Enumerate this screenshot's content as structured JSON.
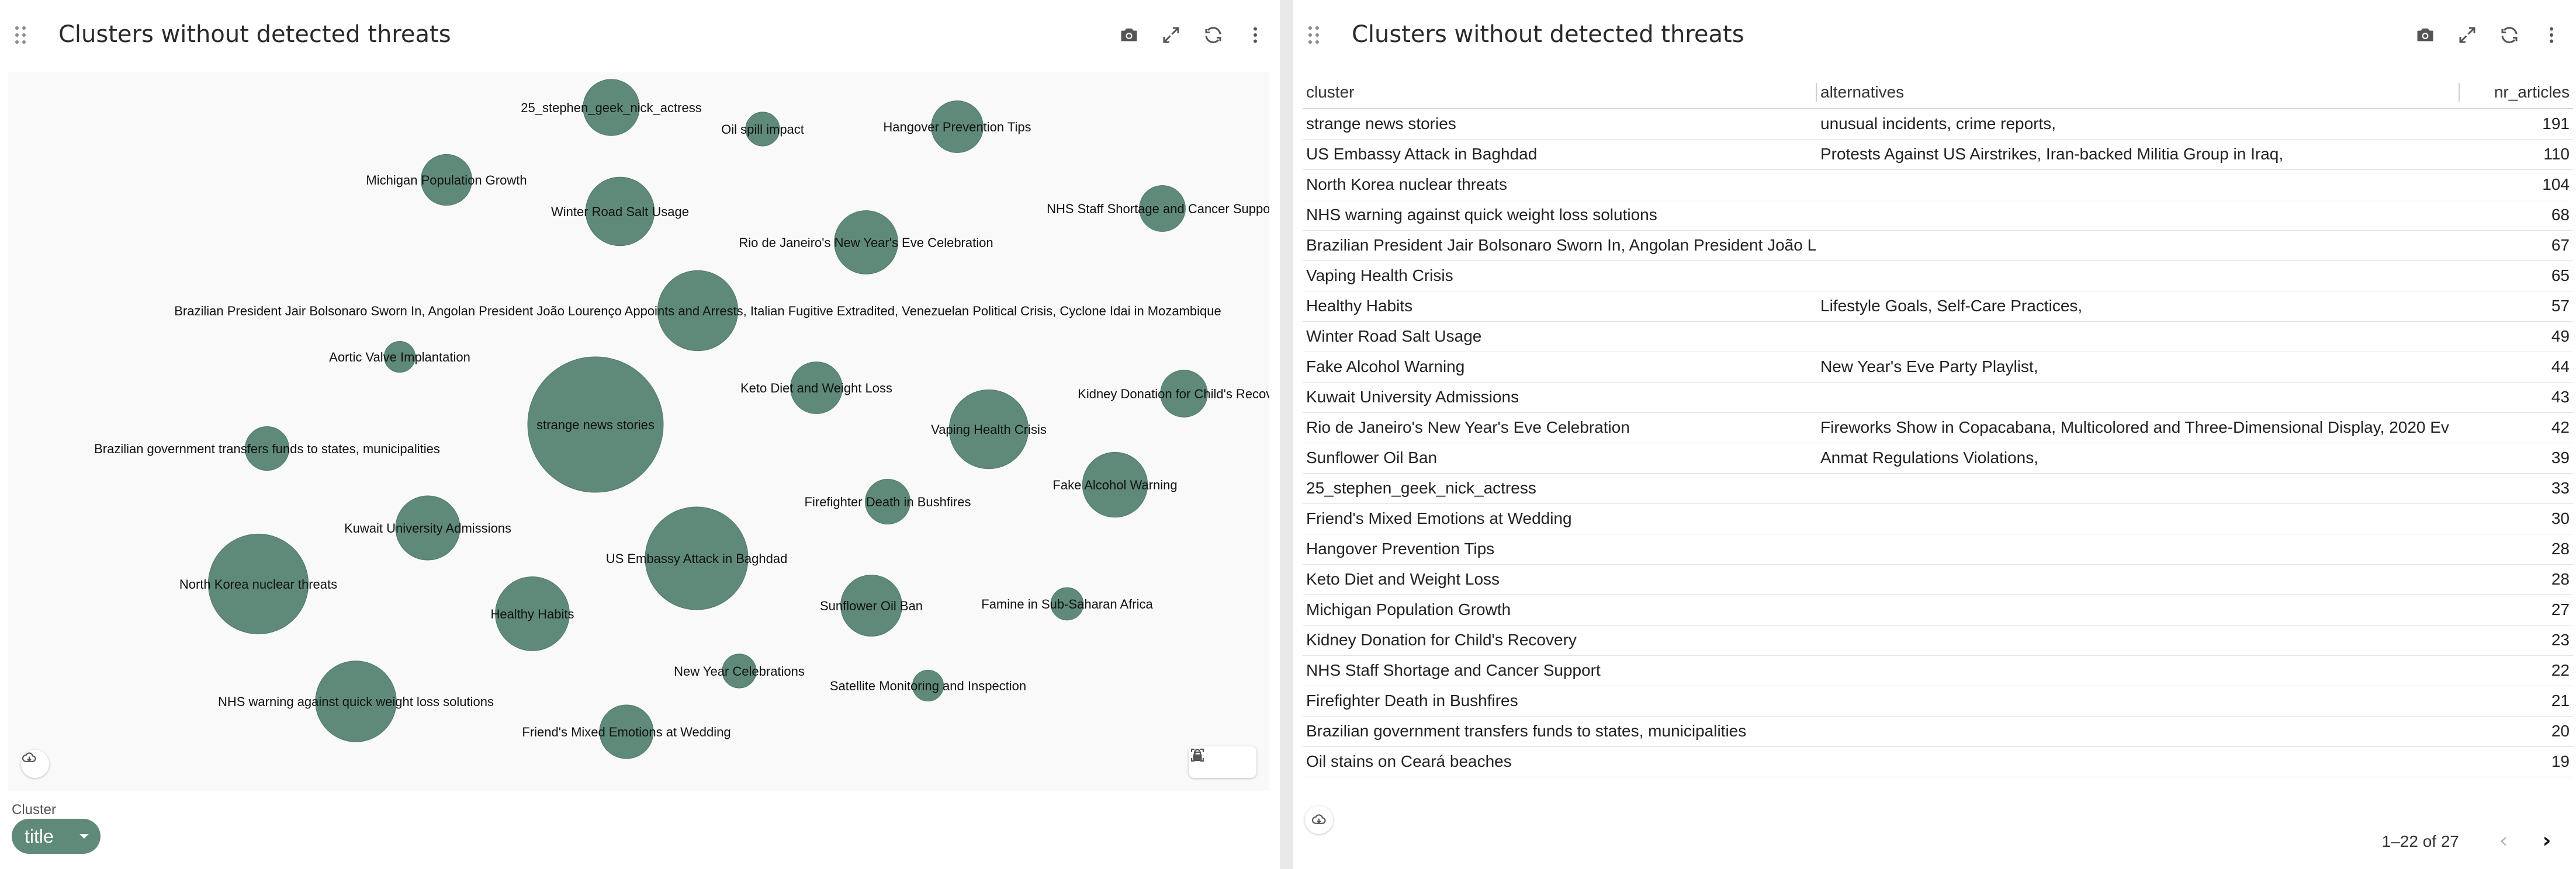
{
  "colors": {
    "bubble": "#5f8a7a",
    "bubble_stroke": "#4f7768",
    "chip": "#5f8a7a"
  },
  "left_panel": {
    "title": "Clusters without detected threats",
    "toolbar_icons": [
      "camera-icon",
      "expand-icon",
      "refresh-icon",
      "more-vertical-icon"
    ],
    "cluster_filter_label": "Cluster",
    "cluster_select_value": "title"
  },
  "chart_data": {
    "type": "scatter",
    "title": "",
    "bubbles": [
      {
        "label": "25_stephen_geek_nick_actress",
        "value": 33
      },
      {
        "label": "Oil spill impact",
        "value": 12
      },
      {
        "label": "Hangover Prevention Tips",
        "value": 28
      },
      {
        "label": "Michigan Population Growth",
        "value": 27
      },
      {
        "label": "Winter Road Salt Usage",
        "value": 49
      },
      {
        "label": "NHS Staff Shortage and Cancer Support",
        "value": 22
      },
      {
        "label": "Rio de Janeiro's New Year's Eve Celebration",
        "value": 42
      },
      {
        "label": "Brazilian President Jair Bolsonaro Sworn In, Angolan President João Lourenço Appoints and Arrests, Italian Fugitive Extradited, Venezuelan Political Crisis, Cyclone Idai in Mozambique",
        "value": 67
      },
      {
        "label": "Aortic Valve Implantation",
        "value": 10
      },
      {
        "label": "strange news stories",
        "value": 191
      },
      {
        "label": "Keto Diet and Weight Loss",
        "value": 28
      },
      {
        "label": "Kidney Donation for Child's Recovery",
        "value": 23
      },
      {
        "label": "Vaping Health Crisis",
        "value": 65
      },
      {
        "label": "Brazilian government transfers funds to states, municipalities",
        "value": 20
      },
      {
        "label": "Fake Alcohol Warning",
        "value": 44
      },
      {
        "label": "Firefighter Death in Bushfires",
        "value": 21
      },
      {
        "label": "Kuwait University Admissions",
        "value": 43
      },
      {
        "label": "US Embassy Attack in Baghdad",
        "value": 110
      },
      {
        "label": "North Korea nuclear threats",
        "value": 104
      },
      {
        "label": "Healthy Habits",
        "value": 57
      },
      {
        "label": "Sunflower Oil Ban",
        "value": 39
      },
      {
        "label": "Famine in Sub-Saharan Africa",
        "value": 11
      },
      {
        "label": "New Year Celebrations",
        "value": 12
      },
      {
        "label": "Satellite Monitoring and Inspection",
        "value": 10
      },
      {
        "label": "NHS warning against quick weight loss solutions",
        "value": 68
      },
      {
        "label": "Friend's Mixed Emotions at Wedding",
        "value": 30
      }
    ]
  },
  "right_panel": {
    "title": "Clusters without detected threats",
    "toolbar_icons": [
      "camera-icon",
      "expand-icon",
      "refresh-icon",
      "more-vertical-icon"
    ],
    "columns": [
      "cluster",
      "alternatives",
      "nr_articles"
    ],
    "rows": [
      {
        "cluster": "strange news stories",
        "alternatives": "unusual incidents, crime reports,",
        "nr_articles": "191"
      },
      {
        "cluster": "US Embassy Attack in Baghdad",
        "alternatives": "Protests Against US Airstrikes, Iran-backed Militia Group in Iraq,",
        "nr_articles": "110"
      },
      {
        "cluster": "North Korea nuclear threats",
        "alternatives": "",
        "nr_articles": "104"
      },
      {
        "cluster": "NHS warning against quick weight loss solutions",
        "alternatives": "",
        "nr_articles": "68"
      },
      {
        "cluster": "Brazilian President Jair Bolsonaro Sworn In, Angolan President João L",
        "alternatives": "",
        "nr_articles": "67"
      },
      {
        "cluster": "Vaping Health Crisis",
        "alternatives": "",
        "nr_articles": "65"
      },
      {
        "cluster": "Healthy Habits",
        "alternatives": "Lifestyle Goals, Self-Care Practices,",
        "nr_articles": "57"
      },
      {
        "cluster": "Winter Road Salt Usage",
        "alternatives": "",
        "nr_articles": "49"
      },
      {
        "cluster": "Fake Alcohol Warning",
        "alternatives": "New Year's Eve Party Playlist,",
        "nr_articles": "44"
      },
      {
        "cluster": "Kuwait University Admissions",
        "alternatives": "",
        "nr_articles": "43"
      },
      {
        "cluster": "Rio de Janeiro's New Year's Eve Celebration",
        "alternatives": "Fireworks Show in Copacabana, Multicolored and Three-Dimensional Display, 2020 Ev",
        "nr_articles": "42"
      },
      {
        "cluster": "Sunflower Oil Ban",
        "alternatives": "Anmat Regulations Violations,",
        "nr_articles": "39"
      },
      {
        "cluster": "25_stephen_geek_nick_actress",
        "alternatives": "",
        "nr_articles": "33"
      },
      {
        "cluster": "Friend's Mixed Emotions at Wedding",
        "alternatives": "",
        "nr_articles": "30"
      },
      {
        "cluster": "Hangover Prevention Tips",
        "alternatives": "",
        "nr_articles": "28"
      },
      {
        "cluster": "Keto Diet and Weight Loss",
        "alternatives": "",
        "nr_articles": "28"
      },
      {
        "cluster": "Michigan Population Growth",
        "alternatives": "",
        "nr_articles": "27"
      },
      {
        "cluster": "Kidney Donation for Child's Recovery",
        "alternatives": "",
        "nr_articles": "23"
      },
      {
        "cluster": "NHS Staff Shortage and Cancer Support",
        "alternatives": "",
        "nr_articles": "22"
      },
      {
        "cluster": "Firefighter Death in Bushfires",
        "alternatives": "",
        "nr_articles": "21"
      },
      {
        "cluster": "Brazilian government transfers funds to states, municipalities",
        "alternatives": "",
        "nr_articles": "20"
      },
      {
        "cluster": "Oil stains on Ceará beaches",
        "alternatives": "",
        "nr_articles": "19"
      }
    ],
    "pagination": {
      "text": "1–22 of 27",
      "prev": "‹",
      "next": "›"
    }
  }
}
